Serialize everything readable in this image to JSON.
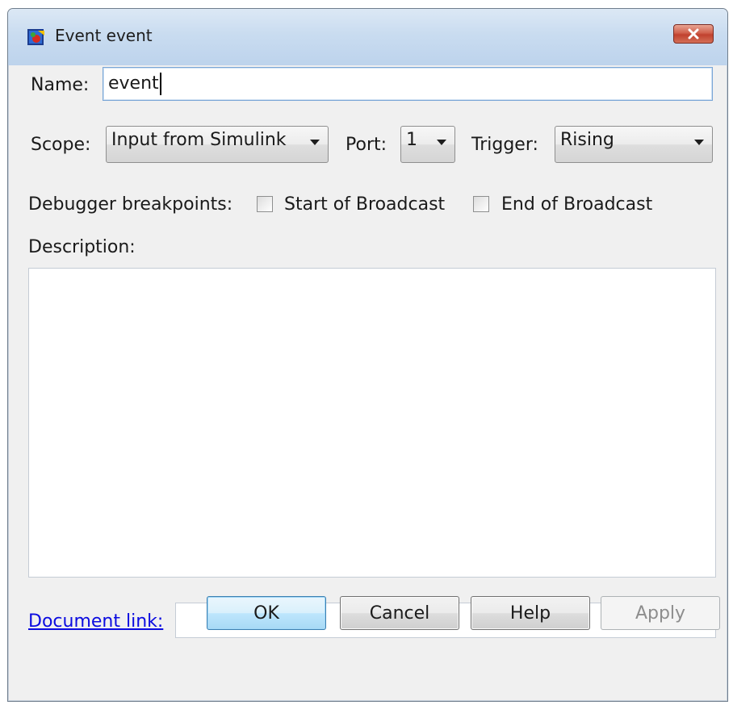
{
  "window": {
    "title": "Event event",
    "app_icon": "stateflow-icon",
    "close_icon": "close-icon"
  },
  "name": {
    "label": "Name:",
    "value": "event"
  },
  "scope": {
    "label": "Scope:",
    "value": "Input from Simulink"
  },
  "port": {
    "label": "Port:",
    "value": "1"
  },
  "trigger": {
    "label": "Trigger:",
    "value": "Rising"
  },
  "breakpoints": {
    "label": "Debugger breakpoints:",
    "start_label": "Start of Broadcast",
    "start_checked": false,
    "end_label": "End of Broadcast",
    "end_checked": false
  },
  "description": {
    "label": "Description:",
    "value": ""
  },
  "document_link": {
    "label": "Document link:",
    "value": ""
  },
  "buttons": {
    "ok": "OK",
    "cancel": "Cancel",
    "help": "Help",
    "apply": "Apply"
  },
  "colors": {
    "link": "#0b0be0",
    "window_bg": "#f0f0f0",
    "close_button": "#c0412e"
  }
}
